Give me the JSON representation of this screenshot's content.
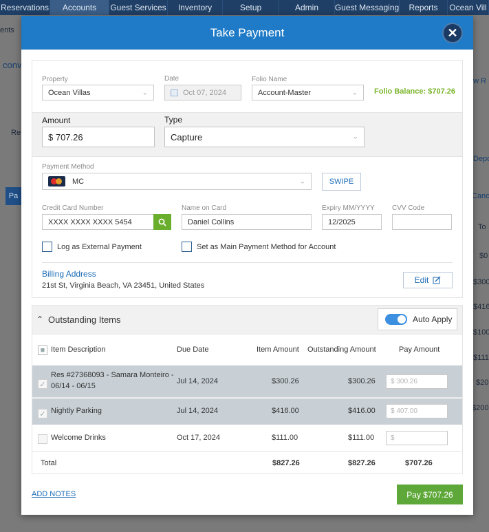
{
  "topnav": {
    "items": [
      "Reservations",
      "Accounts",
      "Guest Services",
      "Inventory",
      "Setup",
      "Admin",
      "Guest Messaging",
      "Reports",
      "Ocean Vill"
    ]
  },
  "background": {
    "ments": "ents",
    "conv": "conv",
    "res": "Res",
    "newr": "ew R",
    "depo": "Depo",
    "canc": "Canc",
    "pa": "Pa",
    "to": "To",
    "vals": [
      "$0",
      "$300",
      "$416",
      "$100",
      "$111",
      "$20",
      "$200"
    ]
  },
  "modal": {
    "title": "Take Payment",
    "close_glyph": "✕",
    "property_label": "Property",
    "property_value": "Ocean Villas",
    "date_label": "Date",
    "date_value": "Oct 07, 2024",
    "folio_label": "Folio Name",
    "folio_value": "Account-Master",
    "folio_balance": "Folio Balance: $707.26",
    "amount_label": "Amount",
    "amount_value": "$ 707.26",
    "type_label": "Type",
    "type_value": "Capture",
    "payment_method_label": "Payment Method",
    "payment_method_value": "MC",
    "swipe_label": "SWIPE",
    "cc_label": "Credit Card Number",
    "cc_value": "XXXX XXXX XXXX 5454",
    "name_label": "Name on Card",
    "name_value": "Daniel Collins",
    "expiry_label": "Expiry MM/YYYY",
    "expiry_value": "12/2025",
    "cvv_label": "CVV Code",
    "log_external_label": "Log as External Payment",
    "main_method_label": "Set as Main Payment Method for Account",
    "billing_label": "Billing Address",
    "billing_value": "21st St, Virginia Beach, VA 23451, United States",
    "edit_label": "Edit"
  },
  "outstanding": {
    "title": "Outstanding Items",
    "auto_apply_label": "Auto Apply",
    "columns": {
      "description": "Item Description",
      "due_date": "Due Date",
      "item_amount": "Item Amount",
      "outstanding_amount": "Outstanding Amount",
      "pay_amount": "Pay Amount"
    },
    "rows": [
      {
        "line1": "Res #27368093 - Samara Monteiro -",
        "line2": "06/14 - 06/15",
        "due": "Jul 14, 2024",
        "item": "$300.26",
        "outstanding": "$300.26",
        "pay": "$ 300.26",
        "checked": true
      },
      {
        "line1": "Nightly Parking",
        "line2": "",
        "due": "Jul 14, 2024",
        "item": "$416.00",
        "outstanding": "$416.00",
        "pay": "$ 407.00",
        "checked": true
      },
      {
        "line1": "Welcome Drinks",
        "line2": "",
        "due": "Oct 17, 2024",
        "item": "$111.00",
        "outstanding": "$111.00",
        "pay": "$",
        "checked": false
      }
    ],
    "total_label": "Total",
    "total_item": "$827.26",
    "total_outstanding": "$827.26",
    "total_pay": "$707.26"
  },
  "footer": {
    "add_notes": "ADD NOTES",
    "pay_button": "Pay $707.26"
  }
}
